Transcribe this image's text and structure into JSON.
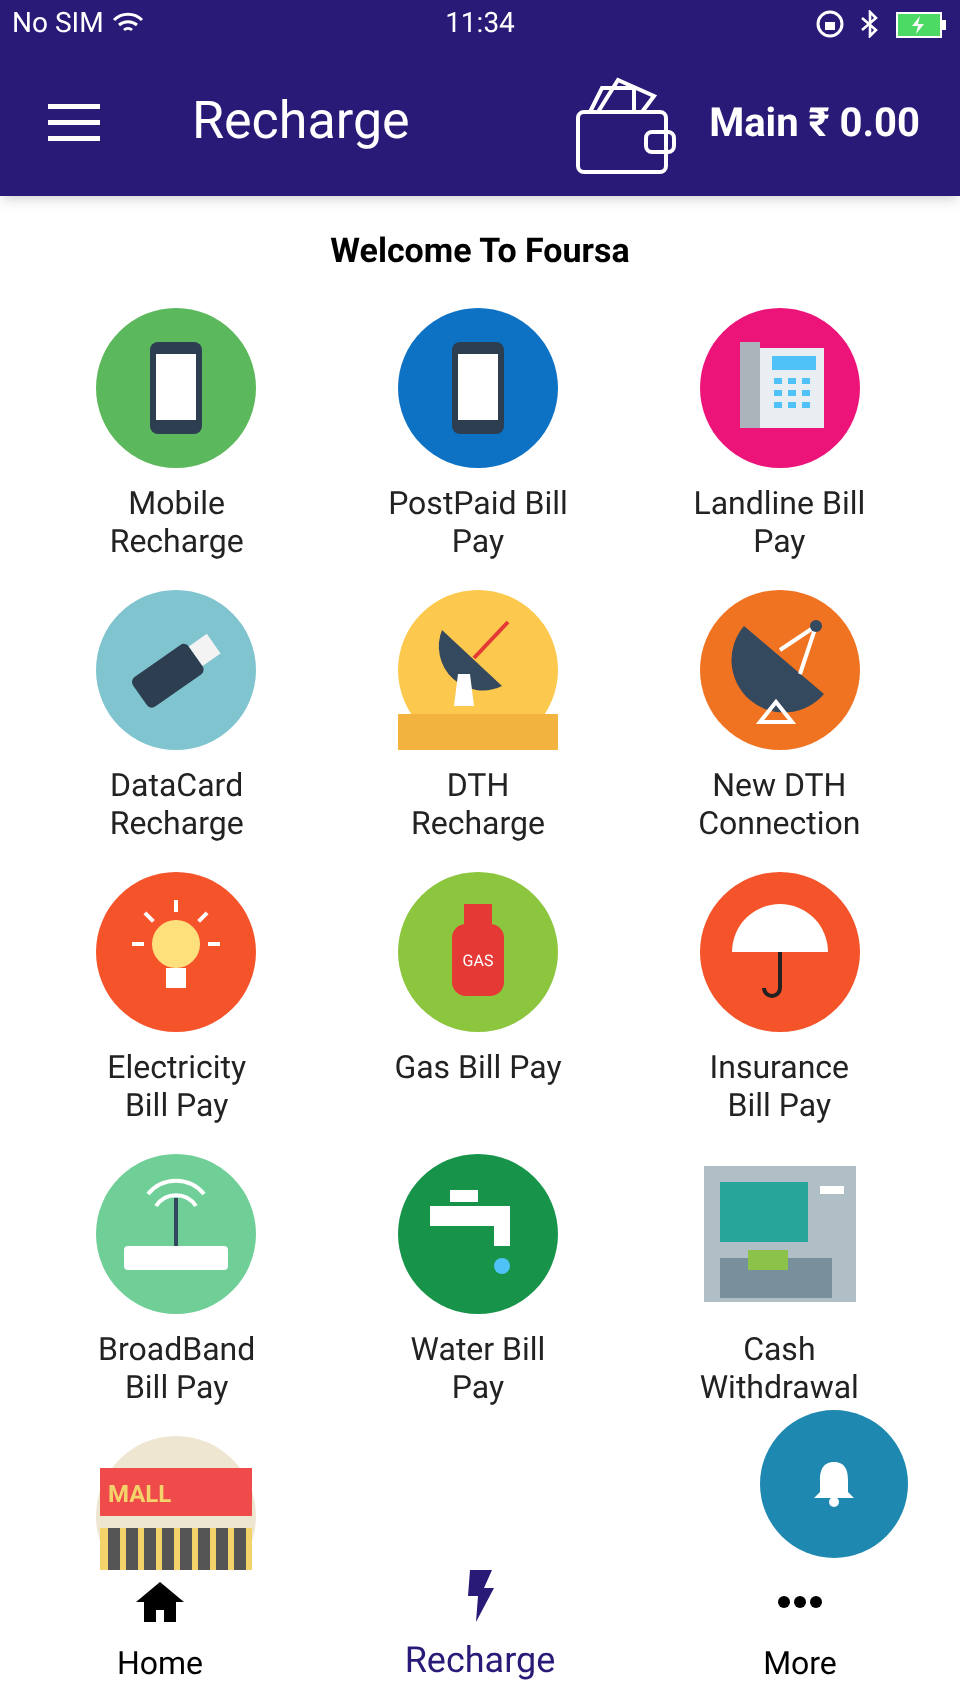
{
  "status_bar": {
    "carrier": "No SIM",
    "time": "11:34"
  },
  "header": {
    "title": "Recharge",
    "balance": "Main ₹ 0.00"
  },
  "welcome": "Welcome To Foursa",
  "services": [
    {
      "kind": "mobile",
      "label": "Mobile\nRecharge"
    },
    {
      "kind": "postpaid",
      "label": "PostPaid Bill\nPay"
    },
    {
      "kind": "landline",
      "label": "Landline Bill\nPay"
    },
    {
      "kind": "datacard",
      "label": "DataCard\nRecharge"
    },
    {
      "kind": "dth",
      "label": "DTH\nRecharge"
    },
    {
      "kind": "newdth",
      "label": "New DTH\nConnection"
    },
    {
      "kind": "electricity",
      "label": "Electricity\nBill Pay"
    },
    {
      "kind": "gas",
      "label": "Gas Bill Pay",
      "badge": "GAS"
    },
    {
      "kind": "insurance",
      "label": "Insurance\nBill Pay"
    },
    {
      "kind": "broadband",
      "label": "BroadBand\nBill Pay"
    },
    {
      "kind": "water",
      "label": "Water Bill\nPay"
    },
    {
      "kind": "cash",
      "label": "Cash\nWithdrawal"
    },
    {
      "kind": "mall",
      "badge": "MALL"
    }
  ],
  "bottom_nav": [
    {
      "kind": "home",
      "label": "Home",
      "selected": false
    },
    {
      "kind": "recharge",
      "label": "Recharge",
      "selected": true
    },
    {
      "kind": "more",
      "label": "More",
      "selected": false
    }
  ]
}
